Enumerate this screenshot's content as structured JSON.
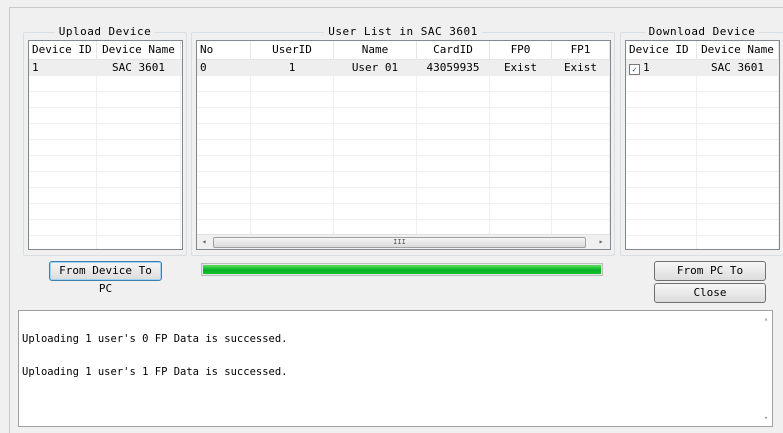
{
  "upload_panel": {
    "title": "Upload Device",
    "columns": [
      "Device ID",
      "Device Name"
    ],
    "rows": [
      {
        "id": "1",
        "name": "SAC 3601"
      }
    ],
    "button_label": "From Device To PC"
  },
  "user_panel": {
    "title": "User List in SAC 3601",
    "columns": [
      "No",
      "UserID",
      "Name",
      "CardID",
      "FP0",
      "FP1"
    ],
    "rows": [
      {
        "no": "0",
        "user_id": "1",
        "name": "User 01",
        "card_id": "43059935",
        "fp0": "Exist",
        "fp1": "Exist"
      }
    ],
    "scroll_left": "◂",
    "scroll_right": "▸",
    "scroll_grip": "III"
  },
  "download_panel": {
    "title": "Download Device",
    "columns": [
      "Device ID",
      "Device Name"
    ],
    "rows": [
      {
        "id": "1",
        "name": "SAC 3601",
        "checked": true,
        "check_mark": "✓"
      }
    ],
    "button_label": "From PC To Device",
    "close_label": "Close"
  },
  "progress": {
    "value": 1.0,
    "color": "#06b025"
  },
  "log": {
    "line1": "Uploading 1 user's 0 FP Data is successed.",
    "line2": "Uploading 1 user's 1 FP Data is successed.",
    "scroll_up": "▴",
    "scroll_down": "▾"
  }
}
